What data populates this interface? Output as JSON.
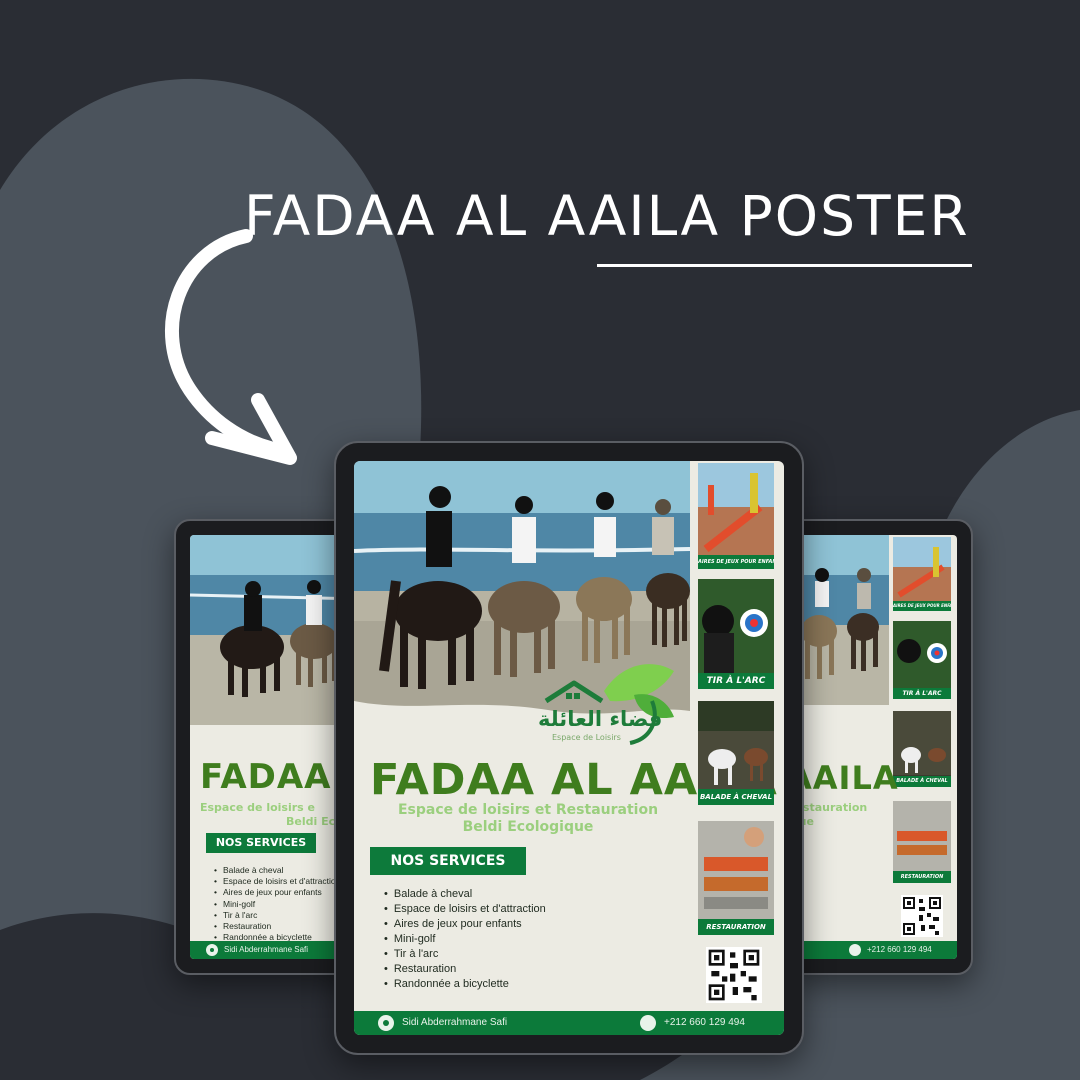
{
  "headline": "FADAA AL AAILA POSTER",
  "colors": {
    "background": "#2a2d34",
    "blob": "#4b535c",
    "brand_green": "#0c7a3a",
    "title_green": "#3f7d1e",
    "subtitle_green": "#9bcf7e",
    "poster_bg": "#ecebe3"
  },
  "icons": {
    "arrow": "curved-arrow-icon",
    "location": "location-pin-icon",
    "phone": "phone-icon",
    "qr": "qr-code-icon",
    "logo": "house-leaf-logo-icon"
  },
  "poster": {
    "logo_arabic": "فضاء العائلة",
    "logo_tagline": "Espace de Loisirs",
    "brand_name": "FADAA AL AAILA",
    "subtitle_line1": "Espace de loisirs et Restauration",
    "subtitle_line2": "Beldi Ecologique",
    "services_title": "NOS SERVICES",
    "services": [
      "Balade à cheval",
      "Espace de loisirs et d'attraction",
      "Aires de jeux pour enfants",
      "Mini-golf",
      "Tir à l'arc",
      "Restauration",
      "Randonnée a bicyclette"
    ],
    "tiles": [
      {
        "caption": "AIRES DE JEUX POUR ENFANTS"
      },
      {
        "caption": "TIR À L'ARC"
      },
      {
        "caption": "BALADE À CHEVAL"
      },
      {
        "caption": "RESTAURATION"
      }
    ],
    "footer_location": "Sidi Abderrahmane Safi",
    "footer_phone": "+212 660 129 494"
  },
  "left_poster": {
    "brand_name": "FADAA AL",
    "subtitle_line1": "Espace de loisirs e",
    "subtitle_line2": "Beldi Ecolog"
  },
  "right_poster": {
    "brand_name": "AAILA",
    "subtitle_line1": "Restauration",
    "subtitle_line2": "ique"
  }
}
